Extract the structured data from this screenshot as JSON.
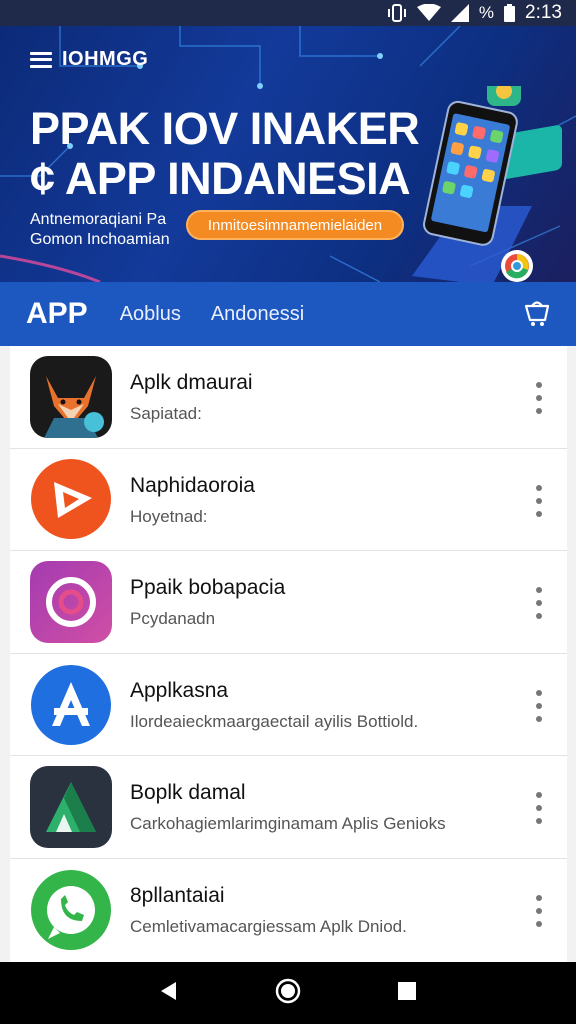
{
  "status_bar": {
    "time": "2:13",
    "battery_label": "%",
    "icons": [
      "vibrate-icon",
      "wifi-icon",
      "signal-icon",
      "battery-icon"
    ]
  },
  "banner": {
    "brand": "IOHMGG",
    "headline_line1": "PPAK IOV INAKER",
    "headline_line2": "¢ APP INDANESIA",
    "subtext_line1": "Antnemoraqiani Pa",
    "subtext_line2": "Gomon Inchoamian",
    "cta_label": "Inmitoesimnamemielaiden"
  },
  "tabs": {
    "main": "APP",
    "tab2": "Aoblus",
    "tab3": "Andonessi"
  },
  "apps": [
    {
      "name": "Aplk dmaurai",
      "subtitle": "Sapiatad:",
      "icon": "fox-app-icon"
    },
    {
      "name": "Naphidaoroia",
      "subtitle": "Hoyetnad:",
      "icon": "play-app-icon"
    },
    {
      "name": "Ppaik bobapacia",
      "subtitle": "Pcydanadn",
      "icon": "ring-app-icon"
    },
    {
      "name": "Applkasna",
      "subtitle": "Ilordeaieckmaargaectail ayilis Bottiold.",
      "icon": "a-letter-app-icon"
    },
    {
      "name": "Boplk damal",
      "subtitle": "Carkohagiemlarimginamam Aplis Genioks",
      "icon": "triangle-app-icon"
    },
    {
      "name": "8pllantaiai",
      "subtitle": "Cemletivamacargiessam Aplk Dniod.",
      "icon": "phone-app-icon"
    }
  ],
  "colors": {
    "banner": "#0c2a78",
    "tabbar": "#1d57c0",
    "cta": "#f48a22",
    "navbar": "#000000"
  },
  "navbar": {
    "icons": [
      "back-icon",
      "home-icon",
      "recents-icon"
    ]
  }
}
